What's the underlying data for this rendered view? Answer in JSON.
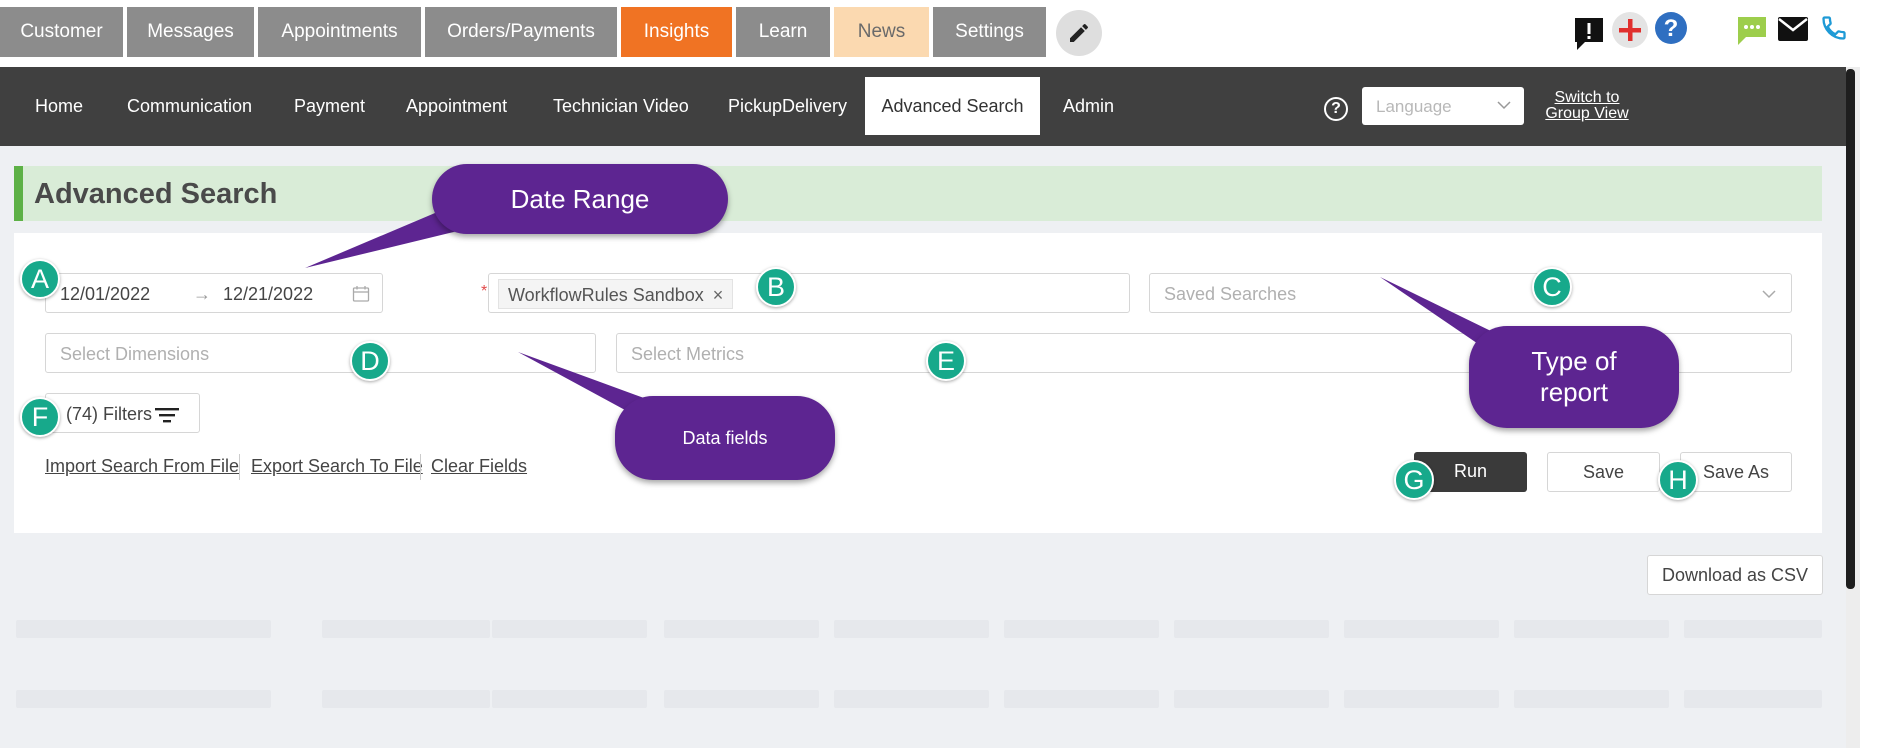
{
  "top_tabs": [
    {
      "label": "Customer"
    },
    {
      "label": "Messages"
    },
    {
      "label": "Appointments"
    },
    {
      "label": "Orders/Payments"
    },
    {
      "label": "Insights"
    },
    {
      "label": "Learn"
    },
    {
      "label": "News"
    },
    {
      "label": "Settings"
    }
  ],
  "top_icons": [
    "pencil-icon",
    "alert-message-icon",
    "plus-icon",
    "help-icon",
    "chat-icon",
    "mail-icon",
    "phone-icon"
  ],
  "nav": {
    "items": [
      {
        "label": "Home"
      },
      {
        "label": "Communication"
      },
      {
        "label": "Payment"
      },
      {
        "label": "Appointment"
      },
      {
        "label": "Technician Video"
      },
      {
        "label": "PickupDelivery"
      },
      {
        "label": "Advanced Search"
      },
      {
        "label": "Admin"
      }
    ],
    "active": "Advanced Search",
    "help": "?",
    "language_placeholder": "Language",
    "switch_line1": "Switch to",
    "switch_line2": "Group View"
  },
  "page": {
    "title": "Advanced Search"
  },
  "form": {
    "date_start": "12/01/2022",
    "date_arrow": "→",
    "date_end": "12/21/2022",
    "workflow_tag": "WorkflowRules Sandbox",
    "workflow_tag_remove": "×",
    "required_mark": "*",
    "saved_searches_placeholder": "Saved Searches",
    "dimensions_placeholder": "Select Dimensions",
    "metrics_placeholder": "Select Metrics",
    "filters_label": "(74) Filters",
    "links": {
      "import": "Import Search From File",
      "export": "Export Search To File",
      "clear": "Clear Fields"
    },
    "buttons": {
      "run": "Run",
      "save": "Save",
      "save_as": "Save As",
      "download_csv": "Download as CSV"
    }
  },
  "annotations": {
    "markers": [
      "A",
      "B",
      "C",
      "D",
      "E",
      "F",
      "G",
      "H"
    ],
    "callouts": {
      "date_range": "Date Range",
      "type_of_report_line1": "Type of",
      "type_of_report_line2": "report",
      "data_fields": "Data fields"
    },
    "color": "#5d2591",
    "marker_color": "#17a98b"
  },
  "colors": {
    "insights_tab": "#f07323",
    "news_tab": "#fbd9b0",
    "nav_bg": "#404040",
    "header_green": "#d9ecd7",
    "accent_green": "#5db146"
  }
}
